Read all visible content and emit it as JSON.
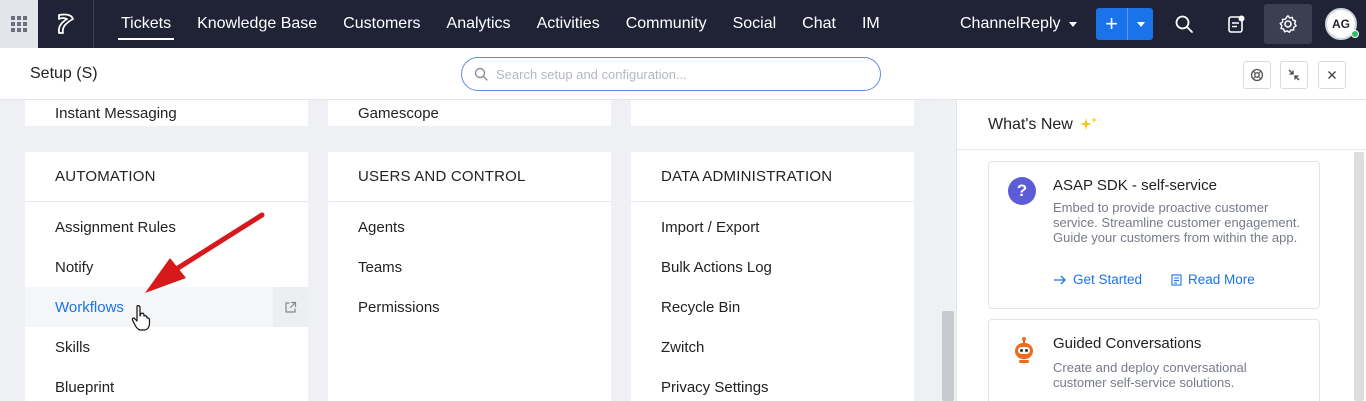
{
  "topnav": {
    "items": [
      {
        "label": "Tickets"
      },
      {
        "label": "Knowledge Base"
      },
      {
        "label": "Customers"
      },
      {
        "label": "Analytics"
      },
      {
        "label": "Activities"
      },
      {
        "label": "Community"
      },
      {
        "label": "Social"
      },
      {
        "label": "Chat"
      },
      {
        "label": "IM"
      }
    ],
    "department": "ChannelReply",
    "add_label": "+",
    "avatar_initials": "AG",
    "icons": [
      "apps-grid-icon",
      "logo-icon",
      "search-icon",
      "notes-icon",
      "gear-icon"
    ]
  },
  "setup": {
    "title": "Setup (S)",
    "search_placeholder": "Search setup and configuration..."
  },
  "sections": {
    "top_row": {
      "col1": "Instant Messaging",
      "col2": "Gamescope"
    },
    "automation": {
      "heading": "AUTOMATION",
      "items": [
        {
          "label": "Assignment Rules"
        },
        {
          "label": "Notify"
        },
        {
          "label": "Workflows"
        },
        {
          "label": "Skills"
        },
        {
          "label": "Blueprint"
        }
      ]
    },
    "users": {
      "heading": "USERS AND CONTROL",
      "items": [
        {
          "label": "Agents"
        },
        {
          "label": "Teams"
        },
        {
          "label": "Permissions"
        }
      ]
    },
    "data_admin": {
      "heading": "DATA ADMINISTRATION",
      "items": [
        {
          "label": "Import / Export"
        },
        {
          "label": "Bulk Actions Log"
        },
        {
          "label": "Recycle Bin"
        },
        {
          "label": "Zwitch"
        },
        {
          "label": "Privacy Settings"
        }
      ]
    }
  },
  "whats_new": {
    "heading": "What's New",
    "cards": [
      {
        "title": "ASAP SDK - self-service",
        "desc": "Embed to provide proactive customer service. Streamline customer engagement. Guide your customers from within the app.",
        "link1": "Get Started",
        "link2": "Read More"
      },
      {
        "title": "Guided Conversations",
        "desc": "Create and deploy conversational customer self-service solutions."
      }
    ]
  },
  "colors": {
    "nav_bg": "#1f2335",
    "accent": "#1a73e8",
    "annotation_arrow": "#d7191c",
    "bot_orange": "#f26b1d"
  }
}
